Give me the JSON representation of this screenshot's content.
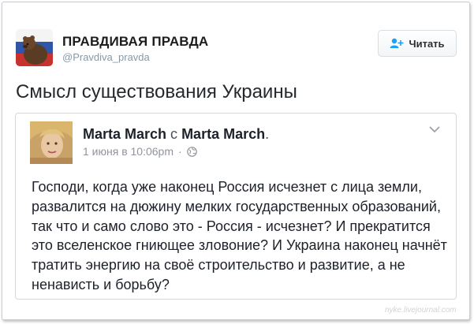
{
  "tweet": {
    "author_name": "ПРАВДИВАЯ ПРАВДА",
    "author_handle": "@Pravdiva_pravda",
    "follow_label": "Читать",
    "text": "Смысл существования Украины"
  },
  "quote": {
    "author": "Marta March",
    "with_word": "с",
    "with_author": "Marta March",
    "date": "1 июня в 10:06pm",
    "separator": "·",
    "body": "Господи, когда уже наконец Россия исчезнет с лица земли, развалится на дюжину мелких государственных образований, так что и само слово это - Россия - исчезнет? И прекратится это вселенское гниющее зловоние? И Украина наконец начнёт тратить энергию на своё строительство и развитие, а не ненависть и борьбу?"
  },
  "watermark": "nyke.livejournal.com",
  "icons": [
    "bear-flag-avatar",
    "follow-user-icon",
    "profile-photo",
    "globe-icon",
    "chevron-down-icon"
  ],
  "colors": {
    "handle": "#8899a6",
    "meta": "#90949c",
    "border": "#d5d9dc"
  }
}
